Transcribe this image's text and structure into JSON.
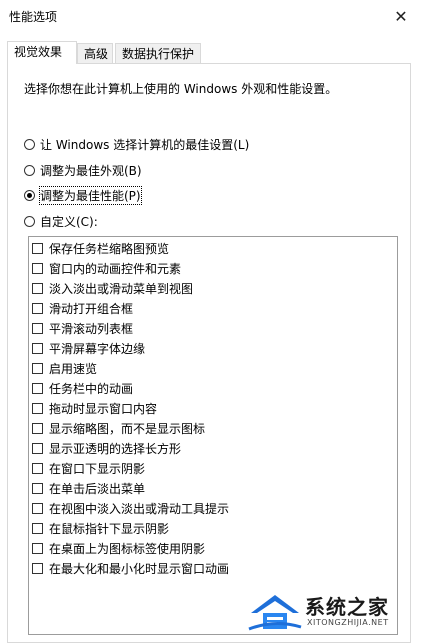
{
  "window": {
    "title": "性能选项",
    "close_glyph": "✕"
  },
  "tabs": [
    {
      "label": "视觉效果",
      "active": true
    },
    {
      "label": "高级",
      "active": false
    },
    {
      "label": "数据执行保护",
      "active": false
    }
  ],
  "visual_effects": {
    "description": "选择你想在此计算机上使用的 Windows 外观和性能设置。",
    "options": [
      {
        "label": "让 Windows 选择计算机的最佳设置(L)",
        "checked": false
      },
      {
        "label": "调整为最佳外观(B)",
        "checked": false
      },
      {
        "label": "调整为最佳性能(P)",
        "checked": true
      },
      {
        "label": "自定义(C):",
        "checked": false
      }
    ],
    "effects": [
      {
        "label": "保存任务栏缩略图预览",
        "checked": false
      },
      {
        "label": "窗口内的动画控件和元素",
        "checked": false
      },
      {
        "label": "淡入淡出或滑动菜单到视图",
        "checked": false
      },
      {
        "label": "滑动打开组合框",
        "checked": false
      },
      {
        "label": "平滑滚动列表框",
        "checked": false
      },
      {
        "label": "平滑屏幕字体边缘",
        "checked": false
      },
      {
        "label": "启用速览",
        "checked": false
      },
      {
        "label": "任务栏中的动画",
        "checked": false
      },
      {
        "label": "拖动时显示窗口内容",
        "checked": false
      },
      {
        "label": "显示缩略图，而不是显示图标",
        "checked": false
      },
      {
        "label": "显示亚透明的选择长方形",
        "checked": false
      },
      {
        "label": "在窗口下显示阴影",
        "checked": false
      },
      {
        "label": "在单击后淡出菜单",
        "checked": false
      },
      {
        "label": "在视图中淡入淡出或滑动工具提示",
        "checked": false
      },
      {
        "label": "在鼠标指针下显示阴影",
        "checked": false
      },
      {
        "label": "在桌面上为图标标签使用阴影",
        "checked": false
      },
      {
        "label": "在最大化和最小化时显示窗口动画",
        "checked": false
      }
    ]
  },
  "watermark": {
    "text": "系统之家",
    "url": "XITONGZHIJIA.NET"
  },
  "colors": {
    "accent_blue": "#1e6fd9",
    "border": "#d9d9d9"
  }
}
